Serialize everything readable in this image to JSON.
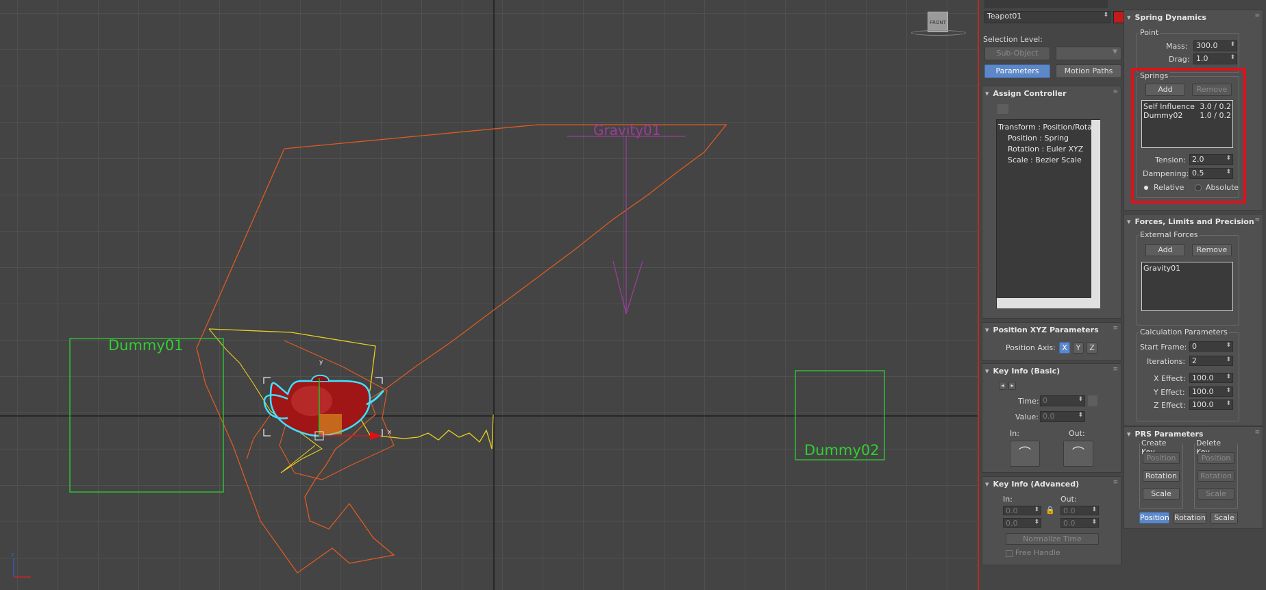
{
  "viewport": {
    "dummy1_label": "Dummy01",
    "dummy2_label": "Dummy02",
    "gravity_label": "Gravity01",
    "viewcube_label": "FRONT",
    "gizmo_x": "x",
    "gizmo_y": "y",
    "axis_z": "z",
    "colors": {
      "dummy": "#30d030",
      "trajectory": "#e05a20",
      "gravity": "#9a3d9a",
      "selection": "#40e0ff",
      "teapot": "#b01818"
    }
  },
  "object": {
    "name": "Teapot01",
    "color": "#c01c1c"
  },
  "motion": {
    "selection_level_label": "Selection Level:",
    "subobject_label": "Sub-Object",
    "parameters_label": "Parameters",
    "motion_paths_label": "Motion Paths"
  },
  "assign_controller": {
    "title": "Assign Controller",
    "tree": [
      "Transform : Position/Rotat",
      "Position : Spring",
      "Rotation : Euler XYZ",
      "Scale : Bezier Scale"
    ]
  },
  "position_xyz": {
    "title": "Position XYZ Parameters",
    "axis_label": "Position Axis:",
    "axes": [
      "X",
      "Y",
      "Z"
    ]
  },
  "key_info_basic": {
    "title": "Key Info (Basic)",
    "time_label": "Time:",
    "time_value": "0",
    "value_label": "Value:",
    "value_value": "0.0",
    "in_label": "In:",
    "out_label": "Out:"
  },
  "key_info_advanced": {
    "title": "Key Info (Advanced)",
    "in_label": "In:",
    "out_label": "Out:",
    "in_values": [
      "0.0",
      "0.0"
    ],
    "out_values": [
      "0.0",
      "0.0"
    ],
    "normalize_label": "Normalize Time",
    "free_handle_label": "Free Handle"
  },
  "spring_dynamics": {
    "title": "Spring Dynamics",
    "point_label": "Point",
    "mass_label": "Mass:",
    "mass_value": "300.0",
    "drag_label": "Drag:",
    "drag_value": "1.0",
    "springs_label": "Springs",
    "add_label": "Add",
    "remove_label": "Remove",
    "springs": [
      {
        "name": "Self Influence",
        "value": "3.0 / 0.2"
      },
      {
        "name": "Dummy02",
        "value": "1.0 / 0.2"
      }
    ],
    "tension_label": "Tension:",
    "tension_value": "2.0",
    "dampening_label": "Dampening:",
    "dampening_value": "0.5",
    "relative_label": "Relative",
    "absolute_label": "Absolute"
  },
  "forces": {
    "title": "Forces, Limits and Precision",
    "external_label": "External Forces",
    "add_label": "Add",
    "remove_label": "Remove",
    "items": [
      "Gravity01"
    ],
    "calc_label": "Calculation Parameters",
    "start_frame_label": "Start Frame:",
    "start_frame_value": "0",
    "iterations_label": "Iterations:",
    "iterations_value": "2",
    "x_effect_label": "X Effect:",
    "x_effect_value": "100.0",
    "y_effect_label": "Y Effect:",
    "y_effect_value": "100.0",
    "z_effect_label": "Z Effect:",
    "z_effect_value": "100.0"
  },
  "prs": {
    "title": "PRS Parameters",
    "create_key_label": "Create Key",
    "delete_key_label": "Delete Key",
    "position_label": "Position",
    "rotation_label": "Rotation",
    "scale_label": "Scale",
    "highlight_color": "#e0101a"
  }
}
